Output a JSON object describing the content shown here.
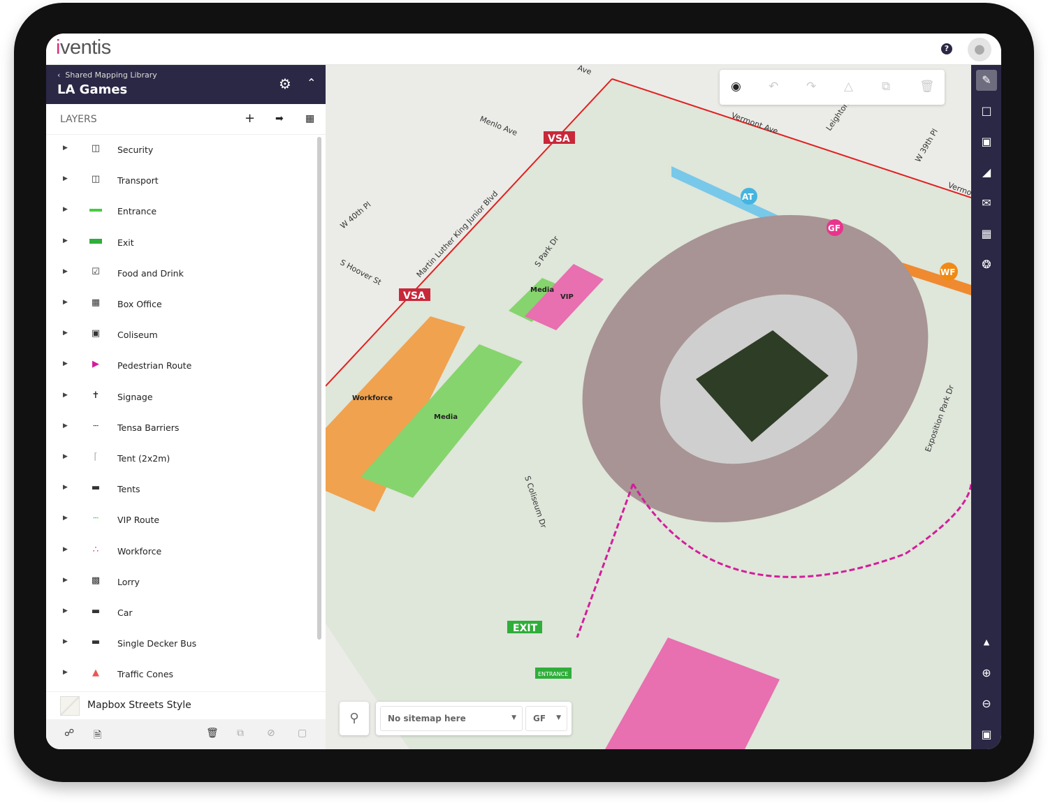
{
  "app": {
    "logo": "iventis",
    "help_icon": "?"
  },
  "project": {
    "breadcrumb": "Shared Mapping Library",
    "title": "LA Games"
  },
  "layers": {
    "heading": "LAYERS",
    "items": [
      {
        "label": "Security",
        "icon": "layer-group-icon"
      },
      {
        "label": "Transport",
        "icon": "layer-group-icon"
      },
      {
        "label": "Entrance",
        "icon": "entrance-line-icon"
      },
      {
        "label": "Exit",
        "icon": "exit-sign-icon"
      },
      {
        "label": "Food and Drink",
        "icon": "food-drink-icon"
      },
      {
        "label": "Box Office",
        "icon": "box-office-icon"
      },
      {
        "label": "Coliseum",
        "icon": "image-icon"
      },
      {
        "label": "Pedestrian Route",
        "icon": "arrow-icon"
      },
      {
        "label": "Signage",
        "icon": "signpost-icon"
      },
      {
        "label": "Tensa Barriers",
        "icon": "barrier-icon"
      },
      {
        "label": "Tent (2x2m)",
        "icon": "tent-icon"
      },
      {
        "label": "Tents",
        "icon": "tents-icon"
      },
      {
        "label": "VIP Route",
        "icon": "route-line-icon"
      },
      {
        "label": "Workforce",
        "icon": "dots-icon"
      },
      {
        "label": "Lorry",
        "icon": "lorry-icon"
      },
      {
        "label": "Car",
        "icon": "car-icon"
      },
      {
        "label": "Single Decker Bus",
        "icon": "bus-icon"
      },
      {
        "label": "Traffic Cones",
        "icon": "cone-icon"
      }
    ]
  },
  "basemap": {
    "label": "Mapbox Streets Style"
  },
  "map": {
    "streets": [
      "Menlo Ave",
      "Vermont Ave",
      "Vermont Ave",
      "Leighton",
      "W 39th Pl",
      "W 40th Pl",
      "Martin Luther King Junior Blvd",
      "S Hoover St",
      "S Park Dr",
      "S Coliseum Dr",
      "Exposition Park Dr",
      "Ave"
    ],
    "zones": {
      "workforce": "Workforce",
      "media": "Media",
      "media2": "Media",
      "vip": "VIP"
    },
    "badges": {
      "vsa": "VSA",
      "at": "AT",
      "gf": "GF",
      "wf": "WF",
      "exit": "EXIT",
      "entrance": "ENTRANCE"
    },
    "sitemap": {
      "value": "No sitemap here",
      "level": "GF"
    }
  },
  "colors": {
    "brand": "#d6317a",
    "nav": "#2a2845",
    "workforce": "#f0a24f",
    "media": "#86d46d",
    "vip": "#e86fb0",
    "route": "#d21e9b",
    "boundary": "#e02020"
  }
}
